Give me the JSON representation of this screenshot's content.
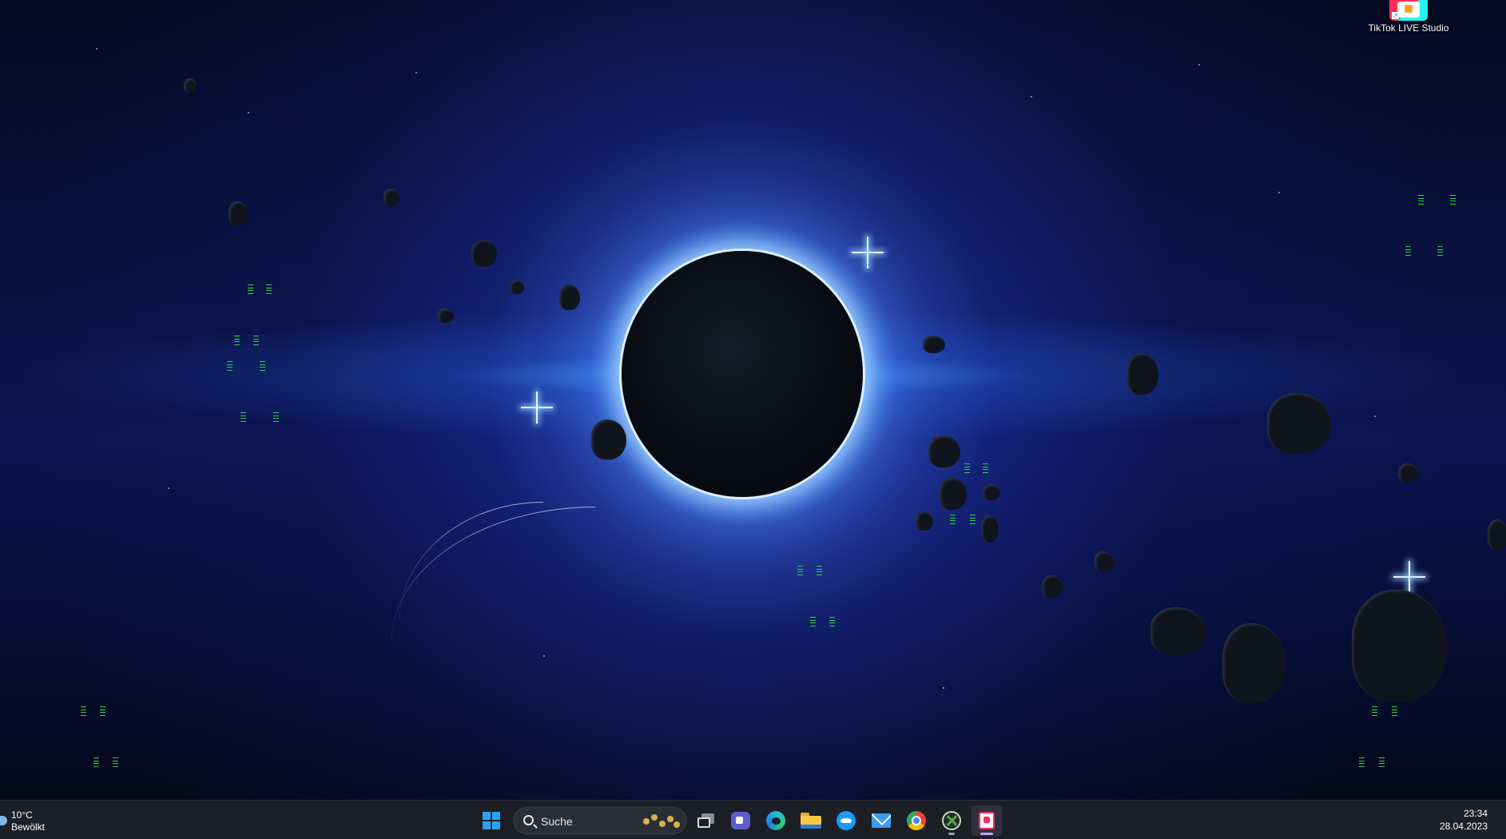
{
  "desktop": {
    "shortcuts": [
      {
        "label": "TikTok LIVE Studio",
        "icon": "tiktok-live-studio-icon"
      }
    ]
  },
  "taskbar": {
    "weather": {
      "temperature": "10°C",
      "condition": "Bewölkt",
      "icon": "cloud-icon"
    },
    "search": {
      "placeholder": "Suche"
    },
    "apps": [
      {
        "name": "Start",
        "icon": "windows-start-icon"
      },
      {
        "name": "Task View",
        "icon": "task-view-icon"
      },
      {
        "name": "Microsoft Teams",
        "icon": "teams-icon"
      },
      {
        "name": "Microsoft Edge",
        "icon": "edge-icon"
      },
      {
        "name": "File Explorer",
        "icon": "file-explorer-icon"
      },
      {
        "name": "Twitter",
        "icon": "twitter-icon"
      },
      {
        "name": "Mail",
        "icon": "mail-icon"
      },
      {
        "name": "Google Chrome",
        "icon": "chrome-icon"
      },
      {
        "name": "Xbox",
        "icon": "xbox-icon"
      },
      {
        "name": "TikTok LIVE Studio",
        "icon": "tiktok-live-studio-icon"
      }
    ],
    "clock": {
      "time": "23:34",
      "date": "28.04.2023"
    }
  },
  "colors": {
    "taskbar_bg": "#1c1f26",
    "accent_blue": "#2aa3f5",
    "matrix_green": "#2cd34a",
    "active_indicator": "#c6a0ff"
  }
}
